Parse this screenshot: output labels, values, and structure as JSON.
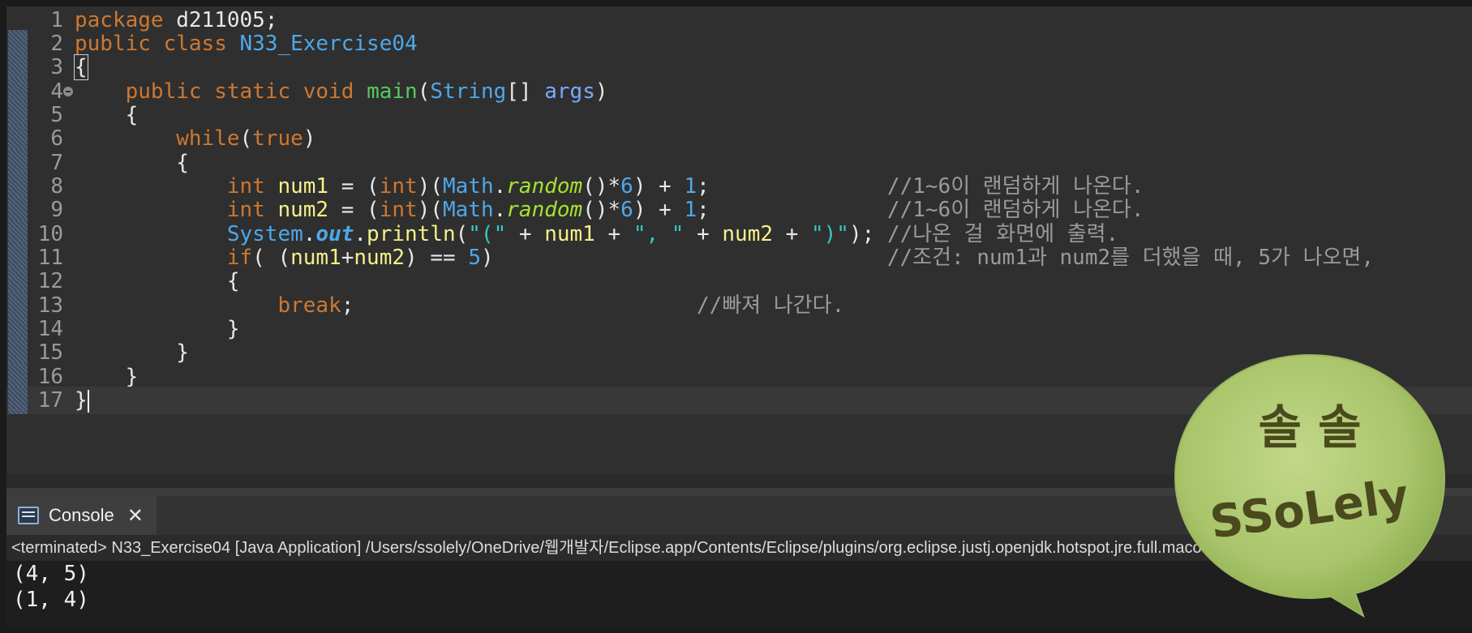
{
  "editor": {
    "lines": [
      {
        "n": "1"
      },
      {
        "n": "2"
      },
      {
        "n": "3"
      },
      {
        "n": "4"
      },
      {
        "n": "5"
      },
      {
        "n": "6"
      },
      {
        "n": "7"
      },
      {
        "n": "8"
      },
      {
        "n": "9"
      },
      {
        "n": "10"
      },
      {
        "n": "11"
      },
      {
        "n": "12"
      },
      {
        "n": "13"
      },
      {
        "n": "14"
      },
      {
        "n": "15"
      },
      {
        "n": "16"
      },
      {
        "n": "17"
      }
    ],
    "tokens": {
      "package_kw": "package",
      "package_name": " d211005;",
      "public_kw": "public",
      "class_kw": "class",
      "class_name": "N33_Exercise04",
      "open_brace": "{",
      "static_kw": "static",
      "void_kw": "void",
      "main_name": "main",
      "string_type": "String",
      "array_brackets": "[] ",
      "args_name": "args",
      "while_kw": "while",
      "true_kw": "true",
      "int_kw": "int",
      "num1": "num1",
      "num2": "num2",
      "math_cls": "Math",
      "random_name": "random",
      "six": "6",
      "one": "1",
      "system_cls": "System",
      "out_field": "out",
      "println_name": "println",
      "str_open": "\"(\"",
      "str_comma": "\", \"",
      "str_close": "\")\"",
      "if_kw": "if",
      "five": "5",
      "break_kw": "break",
      "close_brace": "}"
    },
    "comments": {
      "line8": "//1~6이 랜덤하게 나온다.",
      "line9": "//1~6이 랜덤하게 나온다.",
      "line10": "//나온 걸 화면에 출력.",
      "line11": "//조건: num1과 num2를 더했을 때, 5가 나오면,",
      "line13": "//빠져 나간다."
    }
  },
  "console": {
    "tab_label": "Console",
    "close_glyph": "✕",
    "status": "<terminated> N33_Exercise04 [Java Application] /Users/ssolely/OneDrive/웹개발자/Eclipse.app/Contents/Eclipse/plugins/org.eclipse.justj.openjdk.hotspot.jre.full.macosx.x86",
    "output": [
      "(4, 5)",
      "(1, 4)"
    ]
  },
  "sticker": {
    "line1": "솔 솔",
    "line2": "SSoLely",
    "colors": {
      "bubble": "#a9c46a",
      "text": "#4a4a1e"
    }
  },
  "colors": {
    "editor_bg": "#2f2f2f",
    "keyword": "#cc7832",
    "class": "#4ea8e8",
    "variable": "#f5f08a",
    "string": "#36c7c7",
    "comment": "#9a9a9a"
  }
}
